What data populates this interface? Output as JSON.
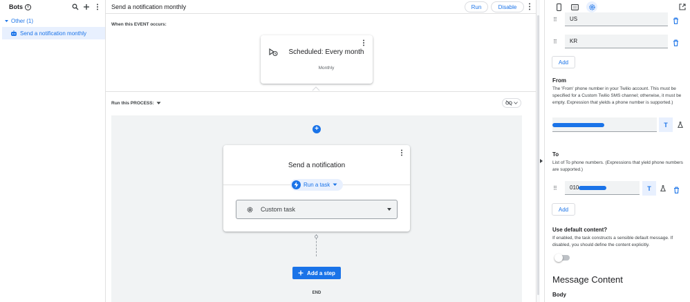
{
  "sidebar": {
    "title": "Bots",
    "group_label": "Other (1)",
    "items": [
      {
        "label": "Send a notification monthly"
      }
    ]
  },
  "header": {
    "title": "Send a notification monthly",
    "run_label": "Run",
    "disable_label": "Disable"
  },
  "event": {
    "section_label": "When this EVENT occurs:",
    "card_title": "Scheduled: Every month",
    "card_subtitle": "Monthly"
  },
  "process": {
    "section_label": "Run this PROCESS:",
    "step_title": "Send a notification",
    "run_task_label": "Run a task",
    "task_select_value": "Custom task",
    "add_step_label": "Add a step",
    "end_label": "END"
  },
  "right_panel": {
    "country_items": [
      "US",
      "KR"
    ],
    "add_label": "Add",
    "from": {
      "title": "From",
      "description": "The 'From' phone number in your Twilio account. This must be specified for a Custom Twilio SMS channel; otherwise, it must be empty. Expression that yields a phone number is supported.)"
    },
    "to": {
      "title": "To",
      "description": "List of To phone numbers. (Expressions that yield phone numbers are supported.)",
      "value_prefix": "010",
      "add_label": "Add"
    },
    "default_content": {
      "title": "Use default content?",
      "description": "If enabled, the task constructs a sensible default message. If disabled, you should define the content explicitly.",
      "enabled": false
    },
    "message_content_heading": "Message Content",
    "body_label": "Body"
  },
  "colors": {
    "accent": "#1a73e8",
    "selected_bg": "#e8f0fe",
    "canvas_bg": "#f1f3f4"
  }
}
